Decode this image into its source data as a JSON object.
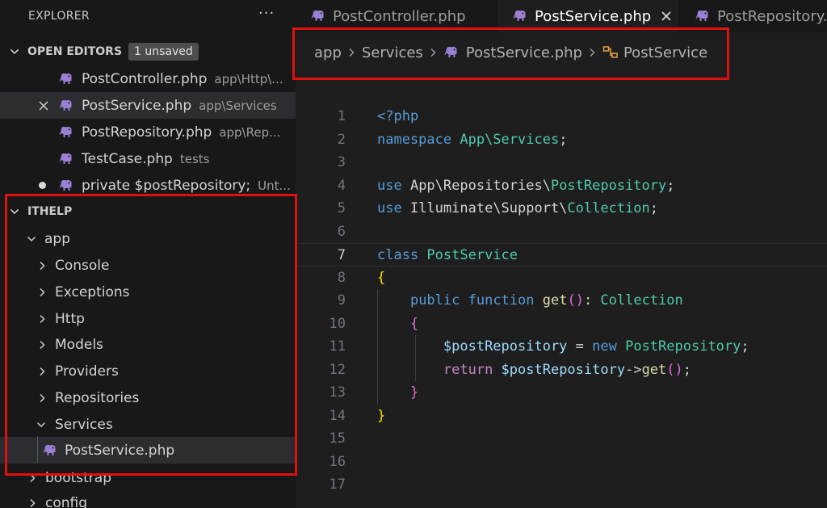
{
  "explorer": {
    "title": "EXPLORER",
    "more_label": "···",
    "open_editors": {
      "title": "OPEN EDITORS",
      "badge": "1 unsaved",
      "items": [
        {
          "name": "PostController.php",
          "path": "app\\Http\\..."
        },
        {
          "name": "PostService.php",
          "path": "app\\Services"
        },
        {
          "name": "PostRepository.php",
          "path": "app\\Rep..."
        },
        {
          "name": "TestCase.php",
          "path": "tests"
        },
        {
          "name": "private $postRepository;",
          "path": "Unt..."
        }
      ]
    },
    "project": {
      "title": "ITHELP",
      "tree": [
        {
          "label": "app"
        },
        {
          "label": "Console"
        },
        {
          "label": "Exceptions"
        },
        {
          "label": "Http"
        },
        {
          "label": "Models"
        },
        {
          "label": "Providers"
        },
        {
          "label": "Repositories"
        },
        {
          "label": "Services"
        },
        {
          "label": "PostService.php"
        },
        {
          "label": "bootstrap"
        },
        {
          "label": "config"
        }
      ]
    }
  },
  "tabs": [
    {
      "label": "PostController.php",
      "active": false
    },
    {
      "label": "PostService.php",
      "active": true
    },
    {
      "label": "PostRepository.php",
      "active": false
    }
  ],
  "breadcrumb": [
    "app",
    "Services",
    "PostService.php",
    "PostService"
  ],
  "editor": {
    "current_line": 7,
    "line_numbers": [
      "1",
      "2",
      "3",
      "4",
      "5",
      "6",
      "7",
      "8",
      "9",
      "10",
      "11",
      "12",
      "13",
      "14",
      "15",
      "16",
      "17"
    ],
    "lines": [
      [
        {
          "t": "<?php",
          "c": "tag"
        }
      ],
      [
        {
          "t": "namespace ",
          "c": "kw"
        },
        {
          "t": "App\\Services",
          "c": "cls"
        },
        {
          "t": ";",
          "c": "plain"
        }
      ],
      [],
      [
        {
          "t": "use ",
          "c": "kw"
        },
        {
          "t": "App\\Repositories\\",
          "c": "plain"
        },
        {
          "t": "PostRepository",
          "c": "cls"
        },
        {
          "t": ";",
          "c": "plain"
        }
      ],
      [
        {
          "t": "use ",
          "c": "kw"
        },
        {
          "t": "Illuminate\\Support\\",
          "c": "plain"
        },
        {
          "t": "Collection",
          "c": "cls"
        },
        {
          "t": ";",
          "c": "plain"
        }
      ],
      [],
      [
        {
          "t": "class ",
          "c": "kw"
        },
        {
          "t": "PostService",
          "c": "cls"
        }
      ],
      [
        {
          "t": "{",
          "c": "b1"
        }
      ],
      [
        {
          "t": "    ",
          "c": "plain"
        },
        {
          "t": "public ",
          "c": "kw"
        },
        {
          "t": "function ",
          "c": "kw"
        },
        {
          "t": "get",
          "c": "fn"
        },
        {
          "t": "()",
          "c": "b2"
        },
        {
          "t": ": ",
          "c": "plain"
        },
        {
          "t": "Collection",
          "c": "cls"
        }
      ],
      [
        {
          "t": "    ",
          "c": "plain"
        },
        {
          "t": "{",
          "c": "b2"
        }
      ],
      [
        {
          "t": "        ",
          "c": "plain"
        },
        {
          "t": "$postRepository",
          "c": "var"
        },
        {
          "t": " = ",
          "c": "plain"
        },
        {
          "t": "new ",
          "c": "kw"
        },
        {
          "t": "PostRepository",
          "c": "cls"
        },
        {
          "t": ";",
          "c": "plain"
        }
      ],
      [
        {
          "t": "        ",
          "c": "plain"
        },
        {
          "t": "return ",
          "c": "ctl"
        },
        {
          "t": "$postRepository",
          "c": "var"
        },
        {
          "t": "->",
          "c": "plain"
        },
        {
          "t": "get",
          "c": "fn"
        },
        {
          "t": "()",
          "c": "b2"
        },
        {
          "t": ";",
          "c": "plain"
        }
      ],
      [
        {
          "t": "    ",
          "c": "plain"
        },
        {
          "t": "}",
          "c": "b2"
        }
      ],
      [
        {
          "t": "}",
          "c": "b1"
        }
      ],
      [],
      [],
      []
    ]
  },
  "colors": {
    "php_icon": "#9b7fd4",
    "highlight_box": "#e01010",
    "symbol_icon": "#e2a03f"
  }
}
